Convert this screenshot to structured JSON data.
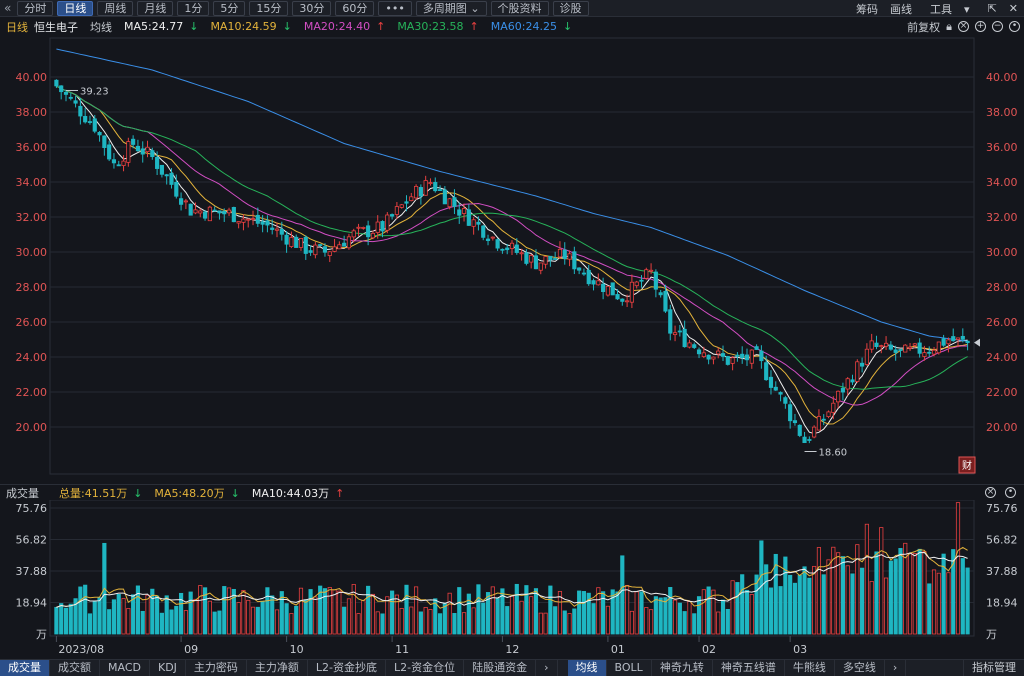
{
  "toolbar": {
    "back_icon": "double-chevron-left-icon",
    "buttons": [
      "分时",
      "日线",
      "周线",
      "月线",
      "1分",
      "5分",
      "15分",
      "30分",
      "60分",
      "•••",
      "多周期图",
      "个股资料",
      "诊股"
    ],
    "active": "日线",
    "right": [
      "筹码",
      "画线",
      "工具"
    ]
  },
  "ma_bar": {
    "period": "日线",
    "stock": "恒生电子",
    "avg_label": "均线",
    "ma5": "MA5:24.77",
    "ma10": "MA10:24.59",
    "ma20": "MA20:24.40",
    "ma30": "MA30:23.58",
    "ma60": "MA60:24.25",
    "adjust": "前复权"
  },
  "colors": {
    "up": "#e84040",
    "down": "#1fb6c2",
    "ma5": "#f0f0f0",
    "ma10": "#e3b33b",
    "ma20": "#d24ec3",
    "ma30": "#27b35a",
    "ma60": "#3a8fe8"
  },
  "price_axis": {
    "ticks": [
      "40.00",
      "38.00",
      "36.00",
      "34.00",
      "32.00",
      "30.00",
      "28.00",
      "26.00",
      "24.00",
      "22.00",
      "20.00"
    ]
  },
  "annotations": {
    "high": "39.23",
    "low": "18.60",
    "fin_badge": "财"
  },
  "x_axis": {
    "labels": [
      "2023/08",
      "09",
      "10",
      "11",
      "12",
      "01",
      "02",
      "03"
    ]
  },
  "volume": {
    "label": "成交量",
    "total": "总量:41.51万",
    "ma5": "MA5:48.20万",
    "ma10": "MA10:44.03万",
    "ticks": [
      "75.76",
      "56.82",
      "37.88",
      "18.94",
      "万"
    ]
  },
  "tabs": {
    "left": [
      "成交量",
      "成交额",
      "MACD",
      "KDJ",
      "主力密码",
      "主力净额",
      "L2-资金抄底",
      "L2-资金仓位",
      "陆股通资金"
    ],
    "left_active": "成交量",
    "right": [
      "均线",
      "BOLL",
      "神奇九转",
      "神奇五线谱",
      "牛熊线",
      "多空线"
    ],
    "right_active": "均线",
    "indicator_mgmt": "指标管理"
  },
  "chart_data": {
    "type": "candlestick",
    "ylim": [
      18.0,
      42.0
    ],
    "days": 152,
    "anchors": [
      [
        0,
        39.5
      ],
      [
        8,
        37.2
      ],
      [
        12,
        35.0
      ],
      [
        16,
        36.2
      ],
      [
        20,
        35.4
      ],
      [
        28,
        32.4
      ],
      [
        36,
        32.2
      ],
      [
        44,
        31.5
      ],
      [
        52,
        30.2
      ],
      [
        56,
        30.0
      ],
      [
        62,
        31.0
      ],
      [
        68,
        31.4
      ],
      [
        74,
        33.2
      ],
      [
        78,
        34.0
      ],
      [
        84,
        32.4
      ],
      [
        92,
        30.6
      ],
      [
        100,
        29.4
      ],
      [
        106,
        29.8
      ],
      [
        112,
        28.4
      ],
      [
        118,
        27.4
      ],
      [
        124,
        28.8
      ],
      [
        128,
        25.5
      ],
      [
        134,
        24.5
      ],
      [
        140,
        23.8
      ],
      [
        146,
        24.0
      ],
      [
        152,
        21.2
      ],
      [
        156,
        19.2
      ],
      [
        160,
        20.5
      ],
      [
        164,
        22.2
      ],
      [
        170,
        24.6
      ],
      [
        176,
        24.2
      ],
      [
        182,
        24.5
      ],
      [
        186,
        25.0
      ],
      [
        190,
        24.8
      ]
    ],
    "ma60_points": [
      [
        0,
        41.6
      ],
      [
        20,
        40.4
      ],
      [
        40,
        38.6
      ],
      [
        60,
        36.2
      ],
      [
        80,
        34.6
      ],
      [
        100,
        33.2
      ],
      [
        112,
        32.2
      ],
      [
        124,
        31.4
      ],
      [
        140,
        29.8
      ],
      [
        156,
        27.8
      ],
      [
        172,
        26.0
      ],
      [
        182,
        25.2
      ],
      [
        190,
        24.9
      ]
    ],
    "volume_ylim": [
      0,
      80
    ],
    "volume_highlights": [
      [
        10,
        54.5
      ],
      [
        118,
        47.0
      ],
      [
        147,
        56.0
      ],
      [
        159,
        52.0
      ],
      [
        169,
        66.0
      ],
      [
        172,
        64.0
      ],
      [
        188,
        79.0
      ]
    ]
  }
}
